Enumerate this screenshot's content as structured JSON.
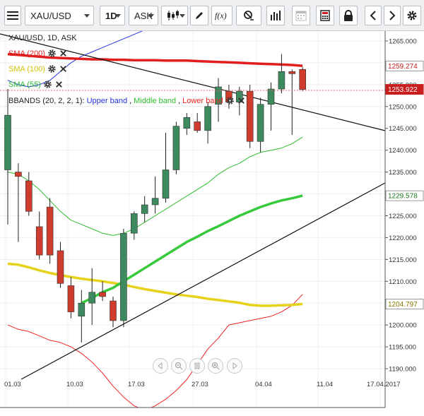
{
  "toolbar": {
    "symbol": "XAU/USD",
    "timeframe": "1D",
    "price_side": "ASK",
    "icons": [
      "menu-icon",
      "candlestick-icon",
      "pencil-icon",
      "function-icon",
      "chart-settings-icon",
      "bar-chart-icon",
      "calendar-icon",
      "calculator-icon",
      "lock-icon",
      "chevron-left-icon",
      "chevron-right-icon",
      "gear-icon"
    ]
  },
  "legend": {
    "instrument": "XAU/USD, 1D, ASK",
    "sma200": "SMA (200)",
    "sma100": "SMA (100)",
    "sma55": "SMA (55)",
    "bbands_prefix": "BBANDS (20, 2, 2, 1): ",
    "bb_upper": "Upper band",
    "bb_middle": "Middle band",
    "bb_lower": "Lower band",
    "sep": ", "
  },
  "colors": {
    "up": "#3d8a5e",
    "down": "#cf3b2c",
    "sma200": "#e11d1d",
    "sma100": "#e6d21a",
    "sma55": "#37c93c",
    "bb_upper": "#2233dd",
    "bb_middle": "#2cbd2c",
    "bb_lower": "#ee2222",
    "trend": "#111111",
    "last_tag": "#c81e1e"
  },
  "price_tags": {
    "sma200": "1259.274",
    "last": "1253.922",
    "sma55": "1229.578",
    "sma100": "1204.797"
  },
  "chart_data": {
    "type": "candlestick",
    "y_axis": {
      "ticks": [
        "1265.000",
        "1260.000",
        "1255.000",
        "1250.000",
        "1245.000",
        "1240.000",
        "1235.000",
        "1230.000",
        "1225.000",
        "1220.000",
        "1215.000",
        "1210.000",
        "1205.000",
        "1200.000",
        "1195.000",
        "1190.000"
      ],
      "range": [
        1187.5,
        1267.5
      ]
    },
    "x_axis": {
      "ticks": [
        "01.03",
        "10.03",
        "17.03",
        "27.03",
        "04.04",
        "11.04",
        "17.04.2017"
      ]
    },
    "candles": [
      {
        "o": 1235.5,
        "h": 1254.0,
        "l": 1223.0,
        "c": 1248.0
      },
      {
        "o": 1235.0,
        "h": 1237.0,
        "l": 1219.0,
        "c": 1234.0
      },
      {
        "o": 1233.0,
        "h": 1235.0,
        "l": 1225.0,
        "c": 1226.0
      },
      {
        "o": 1222.5,
        "h": 1226.0,
        "l": 1215.0,
        "c": 1216.0
      },
      {
        "o": 1227.0,
        "h": 1229.0,
        "l": 1214.0,
        "c": 1216.0
      },
      {
        "o": 1217.0,
        "h": 1219.0,
        "l": 1208.5,
        "c": 1209.5
      },
      {
        "o": 1209.0,
        "h": 1211.0,
        "l": 1201.5,
        "c": 1203.0
      },
      {
        "o": 1202.0,
        "h": 1208.0,
        "l": 1196.0,
        "c": 1205.0
      },
      {
        "o": 1205.0,
        "h": 1213.0,
        "l": 1200.0,
        "c": 1207.5
      },
      {
        "o": 1207.5,
        "h": 1210.0,
        "l": 1205.5,
        "c": 1206.5
      },
      {
        "o": 1205.5,
        "h": 1206.5,
        "l": 1199.5,
        "c": 1201.0
      },
      {
        "o": 1201.0,
        "h": 1222.0,
        "l": 1199.5,
        "c": 1221.0
      },
      {
        "o": 1221.0,
        "h": 1226.0,
        "l": 1219.5,
        "c": 1225.5
      },
      {
        "o": 1225.5,
        "h": 1229.5,
        "l": 1223.5,
        "c": 1227.5
      },
      {
        "o": 1227.5,
        "h": 1234.0,
        "l": 1225.5,
        "c": 1229.0
      },
      {
        "o": 1229.0,
        "h": 1244.0,
        "l": 1228.0,
        "c": 1235.5
      },
      {
        "o": 1235.5,
        "h": 1246.5,
        "l": 1234.5,
        "c": 1245.5
      },
      {
        "o": 1245.0,
        "h": 1248.5,
        "l": 1243.5,
        "c": 1247.5
      },
      {
        "o": 1246.5,
        "h": 1248.5,
        "l": 1244.0,
        "c": 1244.5
      },
      {
        "o": 1244.5,
        "h": 1251.0,
        "l": 1241.5,
        "c": 1250.0
      },
      {
        "o": 1250.5,
        "h": 1256.5,
        "l": 1246.5,
        "c": 1254.5
      },
      {
        "o": 1253.5,
        "h": 1255.0,
        "l": 1249.5,
        "c": 1251.0
      },
      {
        "o": 1251.0,
        "h": 1254.5,
        "l": 1248.0,
        "c": 1253.5
      },
      {
        "o": 1253.5,
        "h": 1255.0,
        "l": 1240.5,
        "c": 1242.0
      },
      {
        "o": 1242.0,
        "h": 1252.0,
        "l": 1239.5,
        "c": 1250.5
      },
      {
        "o": 1250.5,
        "h": 1255.5,
        "l": 1244.5,
        "c": 1254.0
      },
      {
        "o": 1254.0,
        "h": 1262.0,
        "l": 1253.0,
        "c": 1258.0
      },
      {
        "o": 1258.0,
        "h": 1258.5,
        "l": 1243.5,
        "c": 1257.5
      },
      {
        "o": 1258.5,
        "h": 1259.0,
        "l": 1253.5,
        "c": 1253.9
      }
    ],
    "sma200": [
      1262.0,
      1261.8,
      1261.6,
      1261.4,
      1261.2,
      1261.1,
      1261.0,
      1260.9,
      1260.8,
      1260.8,
      1260.7,
      1260.7,
      1260.6,
      1260.6,
      1260.6,
      1260.5,
      1260.5,
      1260.5,
      1260.4,
      1260.3,
      1260.2,
      1260.1,
      1260.0,
      1259.9,
      1259.8,
      1259.7,
      1259.6,
      1259.5,
      1259.3
    ],
    "sma100": [
      1214.0,
      1213.8,
      1213.2,
      1212.5,
      1211.9,
      1211.4,
      1211.0,
      1210.6,
      1210.3,
      1210.0,
      1209.6,
      1209.2,
      1208.7,
      1208.2,
      1207.8,
      1207.4,
      1207.0,
      1206.7,
      1206.4,
      1206.0,
      1205.7,
      1205.4,
      1205.1,
      1204.6,
      1204.4,
      1204.4,
      1204.5,
      1204.6,
      1204.8
    ],
    "sma55": [
      null,
      null,
      null,
      null,
      null,
      null,
      null,
      1205.0,
      1206.2,
      1207.5,
      1208.5,
      1210.0,
      1211.5,
      1213.0,
      1214.5,
      1216.0,
      1217.5,
      1219.0,
      1220.2,
      1221.5,
      1222.6,
      1223.8,
      1225.0,
      1226.0,
      1227.0,
      1227.8,
      1228.5,
      1229.0,
      1229.6
    ],
    "bb_upper": [
      1256.0,
      1255.0,
      1254.5,
      1255.0,
      1256.0,
      1258.0,
      1260.0,
      1261.5,
      1262.5,
      1263.5,
      1264.5,
      1265.5,
      1266.5,
      1267.5,
      1268.5,
      1270.0,
      1271.5,
      1273.0,
      1274.0,
      1275.0
    ],
    "bb_middle": [
      1235.0,
      1234.5,
      1233.0,
      1231.0,
      1228.5,
      1226.0,
      1224.0,
      1223.0,
      1222.0,
      1221.0,
      1220.5,
      1221.0,
      1222.0,
      1223.5,
      1225.0,
      1226.5,
      1228.0,
      1229.5,
      1231.0,
      1232.5,
      1234.5,
      1236.0,
      1237.0,
      1238.5,
      1239.5,
      1240.0,
      1240.5,
      1241.5,
      1243.0
    ],
    "bb_lower": [
      1200.0,
      1199.0,
      1198.5,
      1197.5,
      1196.5,
      1196.0,
      1195.0,
      1193.5,
      1191.5,
      1189.0,
      1186.0,
      1183.5,
      1181.5,
      1180.5,
      1181.5,
      1183.0,
      1185.0,
      1187.5,
      1191.0,
      1194.5,
      1197.0,
      1200.0,
      1200.5,
      1201.0,
      1201.5,
      1202.0,
      1203.0,
      1204.5,
      1207.0
    ]
  }
}
